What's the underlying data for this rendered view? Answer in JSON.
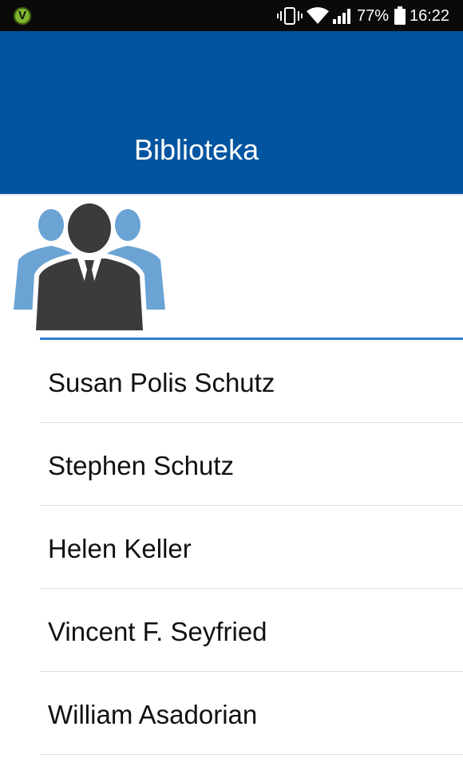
{
  "status_bar": {
    "battery_percent": "77%",
    "time": "16:22",
    "icons": [
      "app-logo-icon",
      "vibrate-icon",
      "wifi-icon",
      "signal-icon",
      "battery-icon"
    ]
  },
  "app_bar": {
    "title": "Biblioteka",
    "background": "#0054a0"
  },
  "header_image": {
    "icon": "people-group-icon"
  },
  "authors": [
    "Susan Polis Schutz",
    "Stephen Schutz",
    "Helen Keller",
    "Vincent F. Seyfried",
    "William Asadorian"
  ],
  "accent_color": "#2f7fd6"
}
